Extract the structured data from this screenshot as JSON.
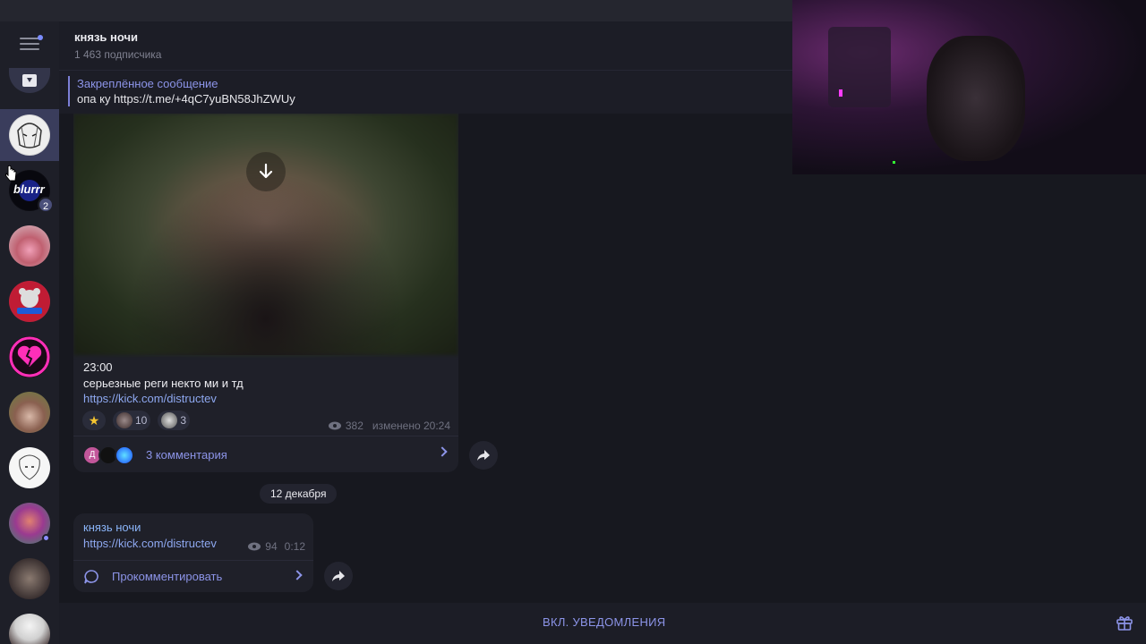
{
  "header": {
    "channel_title": "князь ночи",
    "subscribers": "1 463 подписчика"
  },
  "pinned": {
    "title": "Закреплённое сообщение",
    "text": "опа ку https://t.me/+4qC7yuBN58JhZWUy"
  },
  "sidebar": {
    "items": [
      {
        "name": "archive",
        "badge": ""
      },
      {
        "name": "chat-anime",
        "badge": ""
      },
      {
        "name": "chat-blurrr",
        "label": "blurrr",
        "badge": "2"
      },
      {
        "name": "chat-pink-cup",
        "badge": ""
      },
      {
        "name": "chat-bear",
        "badge": ""
      },
      {
        "name": "chat-broken-heart",
        "badge": ""
      },
      {
        "name": "chat-girl",
        "badge": ""
      },
      {
        "name": "chat-sketch",
        "badge": ""
      },
      {
        "name": "chat-colorful",
        "badge": ""
      },
      {
        "name": "chat-cat",
        "badge": ""
      },
      {
        "name": "chat-hat",
        "badge": ""
      }
    ]
  },
  "messages": [
    {
      "time_text": "23:00",
      "text": "серьезные реги некто ми и тд",
      "link": "https://kick.com/distructev",
      "reactions": [
        {
          "emoji": "star",
          "count": ""
        },
        {
          "emoji": "avatar",
          "count": "10"
        },
        {
          "emoji": "avatar",
          "count": "3"
        }
      ],
      "views": "382",
      "edited": "изменено 20:24",
      "comments": "3 комментария",
      "commenter_initial": "Д"
    },
    {
      "author": "князь ночи",
      "link": "https://kick.com/distructev",
      "views": "94",
      "time": "0:12",
      "comment_action": "Прокомментировать"
    }
  ],
  "date_separator": "12 декабря",
  "bottom": {
    "notify": "ВКЛ. УВЕДОМЛЕНИЯ"
  },
  "colors": {
    "accent": "#8c94e8",
    "link": "#8ea8f0",
    "background": "#17181f",
    "bubble": "#1f2029"
  }
}
